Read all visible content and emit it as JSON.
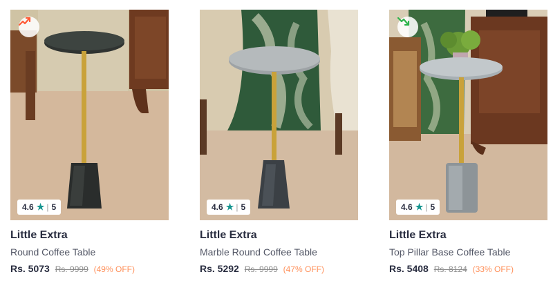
{
  "products": [
    {
      "brand": "Little Extra",
      "name": "Round Coffee Table",
      "price": "Rs. 5073",
      "mrp": "Rs. 9999",
      "discount": "(49% OFF)",
      "rating": "4.6",
      "rating_count": "5",
      "trend_icon": "trend-up-icon",
      "trend_color": "#ff5a36"
    },
    {
      "brand": "Little Extra",
      "name": "Marble Round Coffee Table",
      "price": "Rs. 5292",
      "mrp": "Rs. 9999",
      "discount": "(47% OFF)",
      "rating": "4.6",
      "rating_count": "5"
    },
    {
      "brand": "Little Extra",
      "name": "Top Pillar Base Coffee Table",
      "price": "Rs. 5408",
      "mrp": "Rs. 8124",
      "discount": "(33% OFF)",
      "rating": "4.6",
      "rating_count": "5",
      "trend_icon": "trend-down-icon",
      "trend_color": "#2db34a"
    }
  ],
  "colors": {
    "rating_star": "#14958f",
    "discount": "#ff905a",
    "text": "#282c3f"
  }
}
